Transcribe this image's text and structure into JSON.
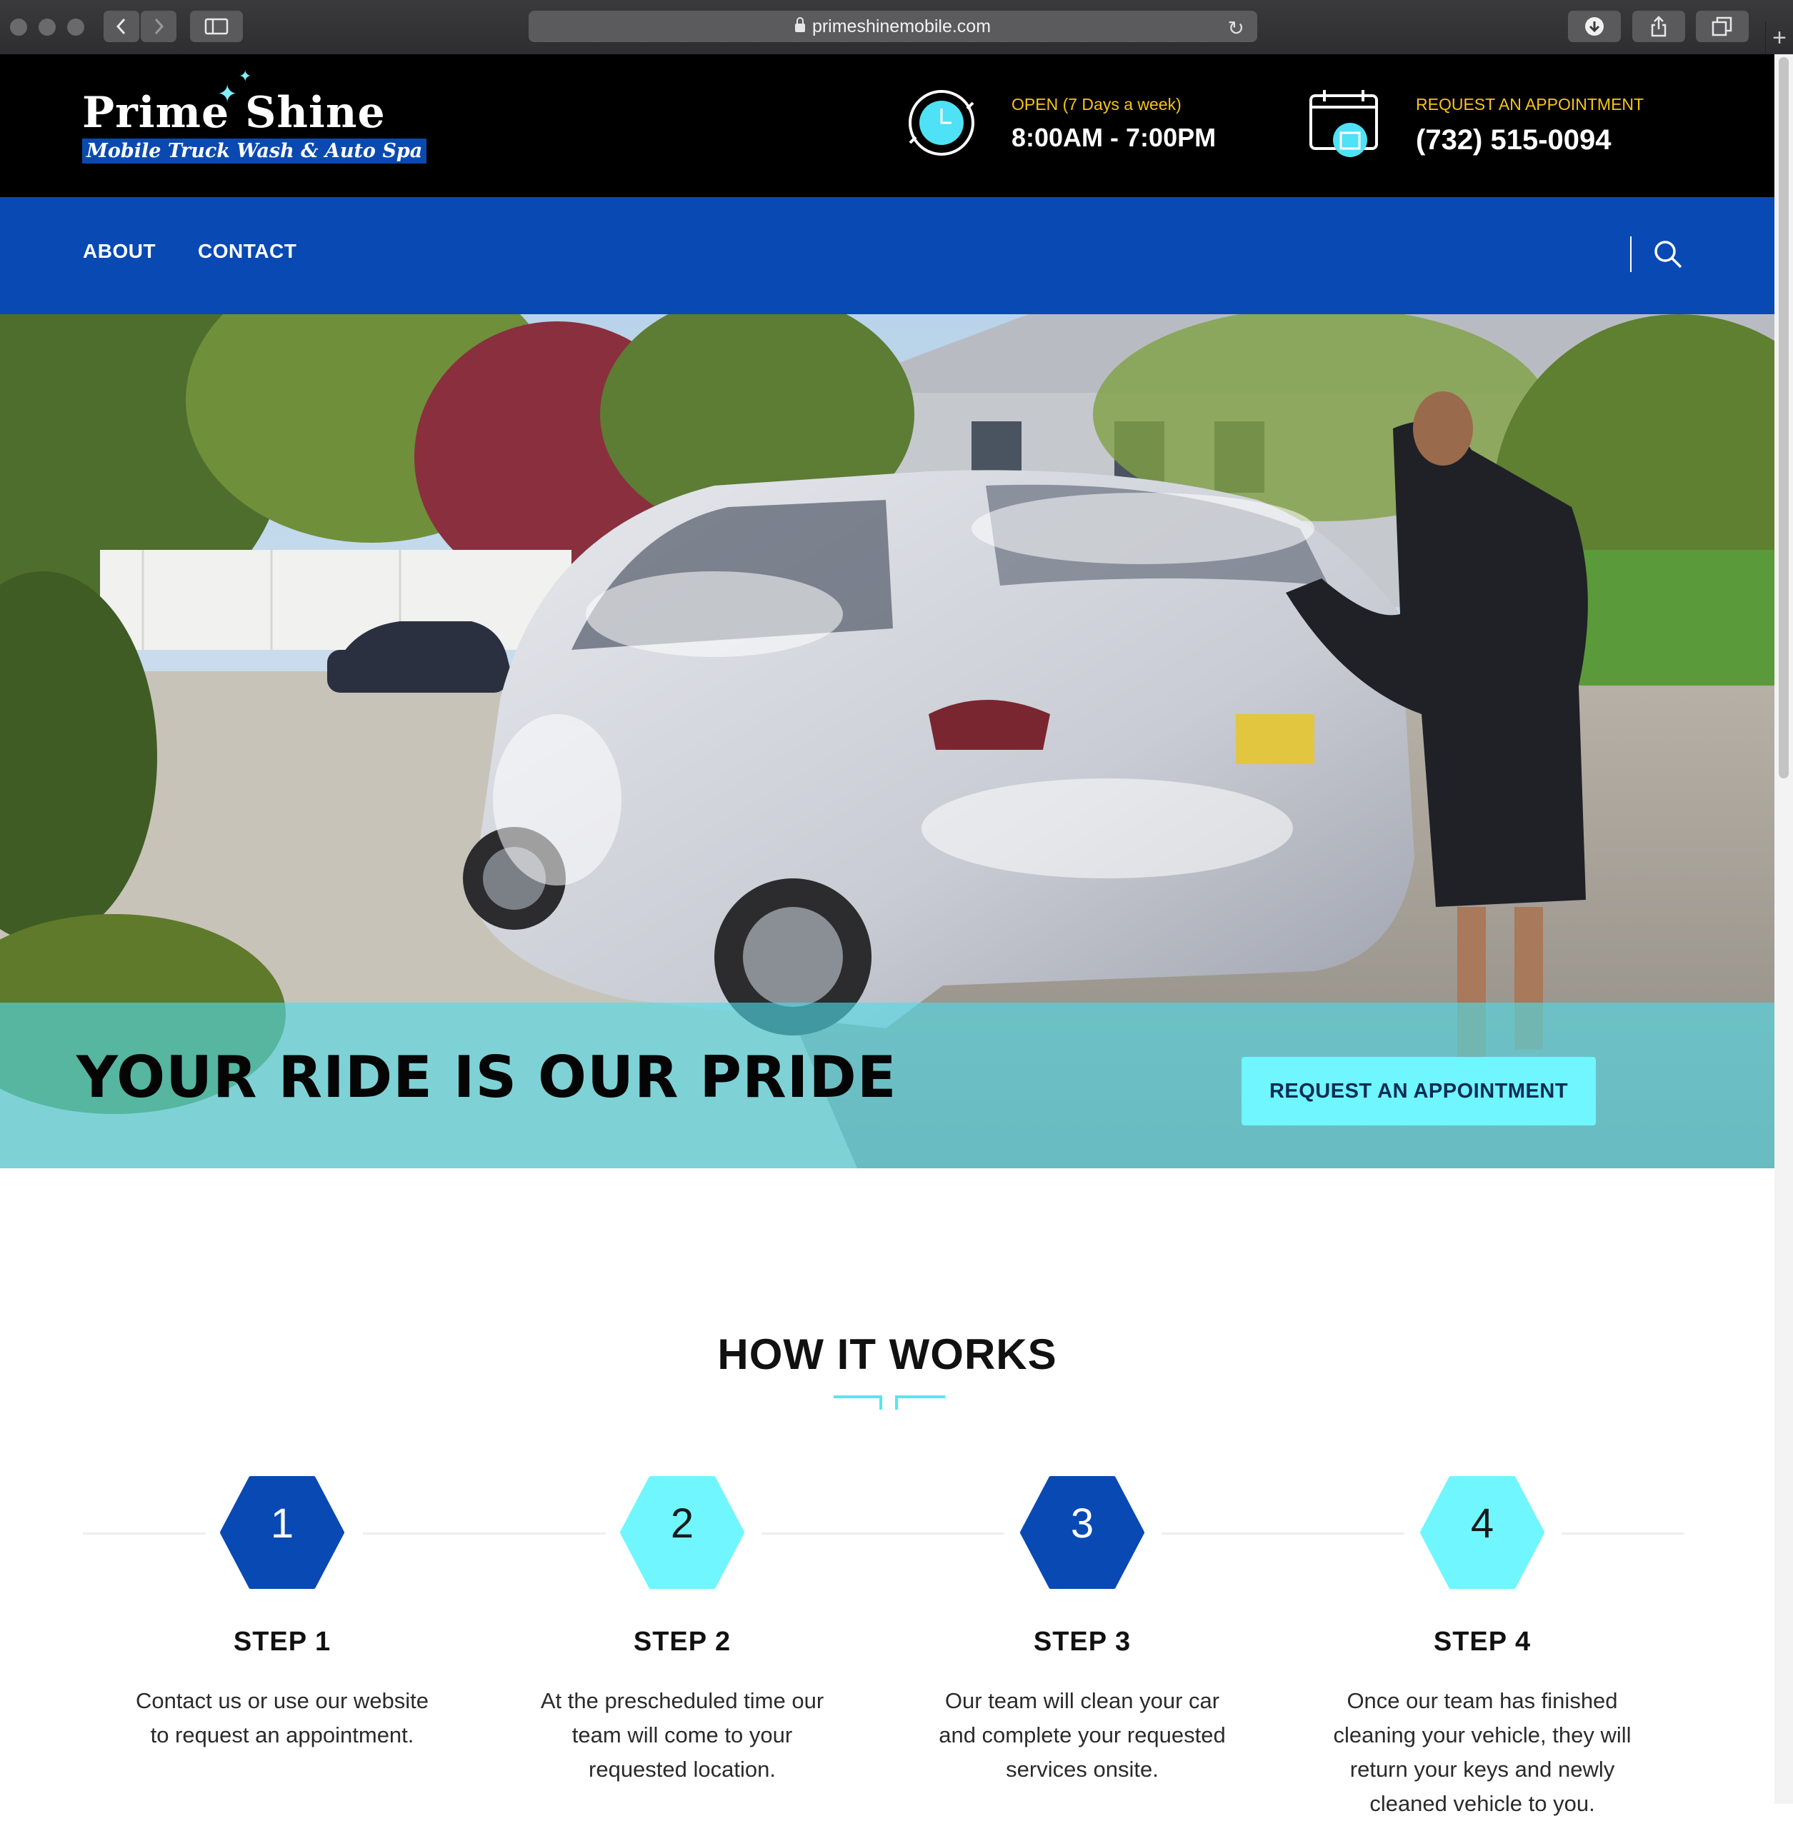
{
  "browser": {
    "url": "primeshinemobile.com"
  },
  "logo": {
    "name": "Prime Shine",
    "tagline": "Mobile Truck Wash & Auto Spa"
  },
  "header": {
    "hours_label": "OPEN (7 Days a week)",
    "hours_value": "8:00AM - 7:00PM",
    "appointment_label": "REQUEST AN APPOINTMENT",
    "phone": "(732) 515-0094"
  },
  "nav": {
    "items": [
      {
        "label": "ABOUT"
      },
      {
        "label": "CONTACT"
      }
    ]
  },
  "hero": {
    "headline": "YOUR RIDE IS OUR PRIDE",
    "cta_label": "REQUEST AN APPOINTMENT"
  },
  "how_it_works": {
    "title": "HOW IT WORKS",
    "steps": [
      {
        "number": "1",
        "title": "STEP 1",
        "text": "Contact us or use our website to request an appointment.",
        "color": "#0849b4"
      },
      {
        "number": "2",
        "title": "STEP 2",
        "text": "At the prescheduled time our team will come to your requested location.",
        "color": "#6ff6ff"
      },
      {
        "number": "3",
        "title": "STEP 3",
        "text": "Our team will clean your car and complete your requested services onsite.",
        "color": "#0849b4"
      },
      {
        "number": "4",
        "title": "STEP 4",
        "text": "Once our team has finished cleaning your vehicle, they will return your keys and newly cleaned vehicle to you.",
        "color": "#6ff6ff"
      }
    ]
  },
  "colors": {
    "brand_blue": "#0849b4",
    "accent_cyan": "#6ff6ff",
    "header_gold": "#f5c518"
  }
}
